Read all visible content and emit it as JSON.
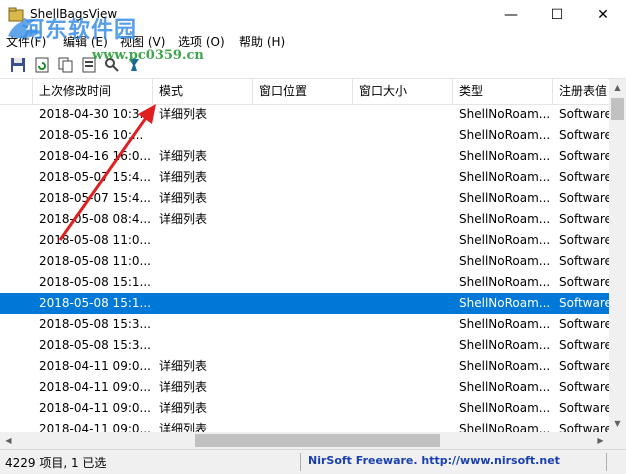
{
  "window": {
    "title": "ShellBagsView",
    "minimize": "—",
    "maximize": "☐",
    "close": "✕"
  },
  "menu": [
    {
      "label": "文件(F)"
    },
    {
      "label": "编辑 (E)"
    },
    {
      "label": "视图 (V)"
    },
    {
      "label": "选项 (O)"
    },
    {
      "label": "帮助 (H)"
    }
  ],
  "toolbar": [
    {
      "icon": "save-icon"
    },
    {
      "icon": "refresh-icon"
    },
    {
      "icon": "copy-icon"
    },
    {
      "icon": "html-report-icon"
    },
    {
      "icon": "find-icon"
    },
    {
      "icon": "about-icon"
    }
  ],
  "watermark": {
    "line1": "河东软件园",
    "line2": "www.pc0359.cn"
  },
  "columns": [
    {
      "label": "上次修改时间"
    },
    {
      "label": "模式"
    },
    {
      "label": "窗口位置"
    },
    {
      "label": "窗口大小"
    },
    {
      "label": "类型"
    },
    {
      "label": "注册表值"
    }
  ],
  "rows": [
    {
      "time": "2018-04-30 10:3...",
      "mode": "详细列表",
      "pos": "",
      "size": "",
      "type": "ShellNoRoam...",
      "reg": "Software",
      "selected": false
    },
    {
      "time": "2018-05-16 10:...",
      "mode": "",
      "pos": "",
      "size": "",
      "type": "ShellNoRoam...",
      "reg": "Software",
      "selected": false
    },
    {
      "time": "2018-04-16 16:0...",
      "mode": "详细列表",
      "pos": "",
      "size": "",
      "type": "ShellNoRoam...",
      "reg": "Software",
      "selected": false
    },
    {
      "time": "2018-05-07 15:4...",
      "mode": "详细列表",
      "pos": "",
      "size": "",
      "type": "ShellNoRoam...",
      "reg": "Software",
      "selected": false
    },
    {
      "time": "2018-05-07 15:4...",
      "mode": "详细列表",
      "pos": "",
      "size": "",
      "type": "ShellNoRoam...",
      "reg": "Software",
      "selected": false
    },
    {
      "time": "2018-05-08 08:4...",
      "mode": "详细列表",
      "pos": "",
      "size": "",
      "type": "ShellNoRoam...",
      "reg": "Software",
      "selected": false
    },
    {
      "time": "2018-05-08 11:0...",
      "mode": "",
      "pos": "",
      "size": "",
      "type": "ShellNoRoam...",
      "reg": "Software",
      "selected": false
    },
    {
      "time": "2018-05-08 11:0...",
      "mode": "",
      "pos": "",
      "size": "",
      "type": "ShellNoRoam...",
      "reg": "Software",
      "selected": false
    },
    {
      "time": "2018-05-08 15:1...",
      "mode": "",
      "pos": "",
      "size": "",
      "type": "ShellNoRoam...",
      "reg": "Software",
      "selected": false
    },
    {
      "time": "2018-05-08 15:1...",
      "mode": "",
      "pos": "",
      "size": "",
      "type": "ShellNoRoam...",
      "reg": "Software",
      "selected": true
    },
    {
      "time": "2018-05-08 15:3...",
      "mode": "",
      "pos": "",
      "size": "",
      "type": "ShellNoRoam...",
      "reg": "Software",
      "selected": false
    },
    {
      "time": "2018-05-08 15:3...",
      "mode": "",
      "pos": "",
      "size": "",
      "type": "ShellNoRoam...",
      "reg": "Software",
      "selected": false
    },
    {
      "time": "2018-04-11 09:0...",
      "mode": "详细列表",
      "pos": "",
      "size": "",
      "type": "ShellNoRoam...",
      "reg": "Software",
      "selected": false
    },
    {
      "time": "2018-04-11 09:0...",
      "mode": "详细列表",
      "pos": "",
      "size": "",
      "type": "ShellNoRoam...",
      "reg": "Software",
      "selected": false
    },
    {
      "time": "2018-04-11 09:0...",
      "mode": "详细列表",
      "pos": "",
      "size": "",
      "type": "ShellNoRoam...",
      "reg": "Software",
      "selected": false
    },
    {
      "time": "2018-04-11 09:0...",
      "mode": "详细列表",
      "pos": "",
      "size": "",
      "type": "ShellNoRoam...",
      "reg": "Software",
      "selected": false
    }
  ],
  "status": {
    "count": "4229 项目, 1 已选",
    "link": "NirSoft Freeware.  http://www.nirsoft.net"
  },
  "colors": {
    "selection": "#0078d7",
    "annotation_arrow": "#e02020",
    "link": "#1a3fb0"
  }
}
